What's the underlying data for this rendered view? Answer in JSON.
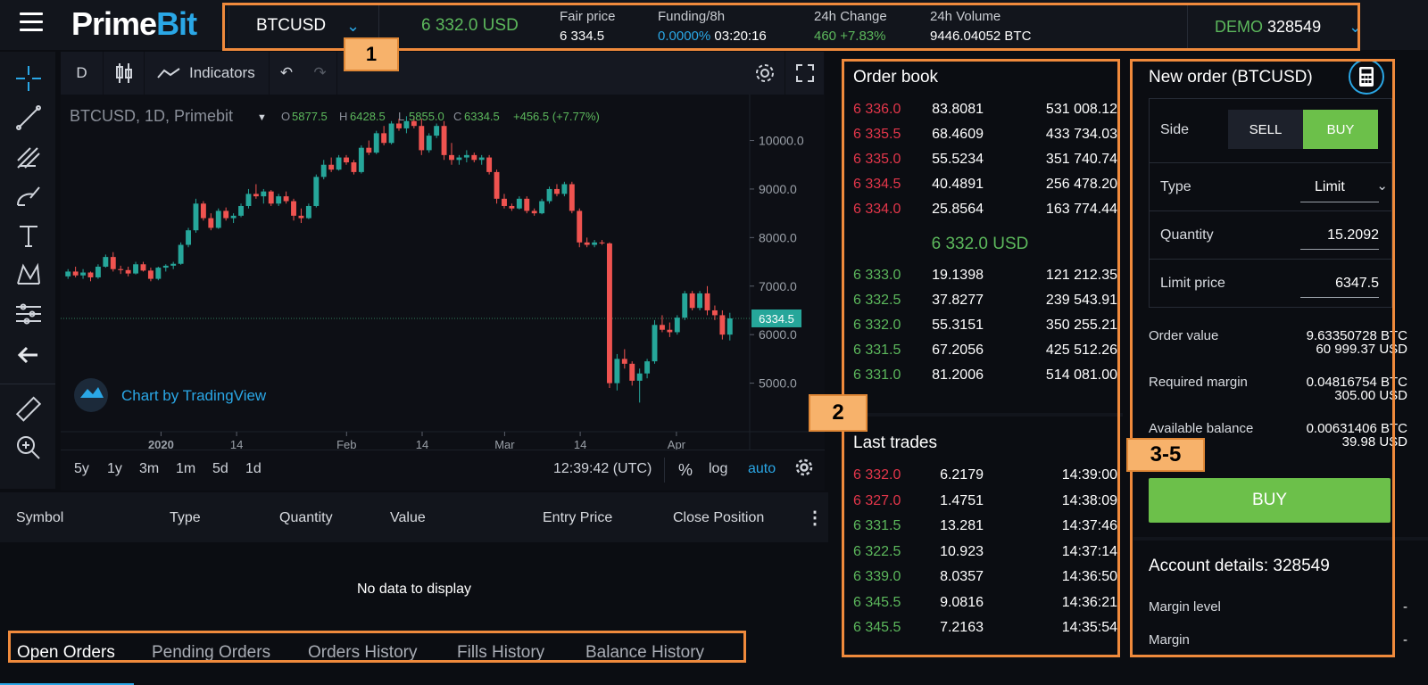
{
  "header": {
    "logo_prime": "Prime",
    "logo_bit": "Bit",
    "symbol": "BTCUSD",
    "last_price": "6 332.0 USD",
    "fair_price_label": "Fair price",
    "fair_price": "6 334.5",
    "funding_label": "Funding/8h",
    "funding_rate": "0.0000%",
    "funding_time": "03:20:16",
    "change_label": "24h Change",
    "change_value": "460 +7.83%",
    "volume_label": "24h Volume",
    "volume_value": "9446.04052 BTC",
    "account_label": "DEMO",
    "account_number": "328549"
  },
  "badges": {
    "b1": "1",
    "b2": "2",
    "b3": "3-5"
  },
  "tools": [
    "crosshair-icon",
    "trendline-icon",
    "pitchfork-icon",
    "brush-icon",
    "text-icon",
    "pattern-icon",
    "measure-lines-icon",
    "back-arrow-icon",
    "ruler-icon",
    "zoom-icon"
  ],
  "chart_toolbar": {
    "interval": "D",
    "indicators": "Indicators"
  },
  "chart": {
    "legend_symbol": "BTCUSD, 1D, Primebit",
    "o_label": "O",
    "o": "5877.5",
    "h_label": "H",
    "h": "6428.5",
    "l_label": "L",
    "l": "5855.0",
    "c_label": "C",
    "c": "6334.5",
    "change": "+456.5 (+7.77%)",
    "watermark": "Chart by TradingView",
    "last_price_tag": "6334.5",
    "y_ticks": [
      "10000.0",
      "9000.0",
      "8000.0",
      "7000.0",
      "6000.0",
      "5000.0"
    ],
    "x_ticks": [
      "2020",
      "14",
      "Feb",
      "14",
      "Mar",
      "14",
      "Apr"
    ]
  },
  "chart_data": {
    "type": "candlestick",
    "title": "BTCUSD, 1D, Primebit",
    "ylim": [
      4000,
      10800
    ],
    "up_color": "#26a69a",
    "down_color": "#ef5350",
    "candles": [
      [
        7200,
        7350,
        7150,
        7300
      ],
      [
        7300,
        7400,
        7180,
        7220
      ],
      [
        7220,
        7350,
        7150,
        7280
      ],
      [
        7280,
        7300,
        7100,
        7180
      ],
      [
        7180,
        7450,
        7150,
        7400
      ],
      [
        7400,
        7650,
        7380,
        7600
      ],
      [
        7600,
        7700,
        7300,
        7350
      ],
      [
        7350,
        7420,
        7250,
        7330
      ],
      [
        7330,
        7400,
        7200,
        7260
      ],
      [
        7260,
        7500,
        7240,
        7450
      ],
      [
        7450,
        7500,
        7300,
        7320
      ],
      [
        7320,
        7380,
        7100,
        7150
      ],
      [
        7150,
        7400,
        7120,
        7380
      ],
      [
        7380,
        7450,
        7300,
        7420
      ],
      [
        7420,
        7500,
        7350,
        7460
      ],
      [
        7460,
        7900,
        7440,
        7850
      ],
      [
        7850,
        8200,
        7800,
        8150
      ],
      [
        8150,
        8800,
        8100,
        8700
      ],
      [
        8700,
        8750,
        8350,
        8400
      ],
      [
        8400,
        8500,
        8150,
        8200
      ],
      [
        8200,
        8600,
        8180,
        8550
      ],
      [
        8550,
        8620,
        8350,
        8400
      ],
      [
        8400,
        8500,
        8300,
        8450
      ],
      [
        8450,
        8700,
        8420,
        8650
      ],
      [
        8650,
        9000,
        8600,
        8900
      ],
      [
        8900,
        9100,
        8800,
        8850
      ],
      [
        8850,
        9000,
        8700,
        8950
      ],
      [
        8950,
        8980,
        8650,
        8700
      ],
      [
        8700,
        8900,
        8650,
        8850
      ],
      [
        8850,
        8950,
        8700,
        8750
      ],
      [
        8750,
        8800,
        8350,
        8450
      ],
      [
        8450,
        8600,
        8300,
        8400
      ],
      [
        8400,
        8700,
        8380,
        8650
      ],
      [
        8650,
        9300,
        8620,
        9250
      ],
      [
        9250,
        9600,
        9200,
        9500
      ],
      [
        9500,
        9650,
        9350,
        9400
      ],
      [
        9400,
        9700,
        9380,
        9650
      ],
      [
        9650,
        9700,
        9500,
        9550
      ],
      [
        9550,
        9600,
        9300,
        9350
      ],
      [
        9350,
        9900,
        9320,
        9850
      ],
      [
        9850,
        10000,
        9700,
        9750
      ],
      [
        9750,
        10200,
        9720,
        10150
      ],
      [
        10150,
        10300,
        9900,
        9950
      ],
      [
        9950,
        10400,
        9920,
        10350
      ],
      [
        10350,
        10450,
        10200,
        10250
      ],
      [
        10250,
        10500,
        10150,
        10400
      ],
      [
        10400,
        10500,
        10250,
        10300
      ],
      [
        10300,
        10450,
        9700,
        9800
      ],
      [
        9800,
        10150,
        9750,
        10100
      ],
      [
        10100,
        10350,
        10050,
        10300
      ],
      [
        10300,
        10400,
        9600,
        9700
      ],
      [
        9700,
        9950,
        9500,
        9600
      ],
      [
        9600,
        9700,
        9500,
        9650
      ],
      [
        9650,
        9800,
        9550,
        9700
      ],
      [
        9700,
        9750,
        9550,
        9600
      ],
      [
        9600,
        9700,
        9500,
        9650
      ],
      [
        9650,
        9700,
        9300,
        9350
      ],
      [
        9350,
        9400,
        8700,
        8800
      ],
      [
        8800,
        8900,
        8600,
        8650
      ],
      [
        8650,
        8700,
        8550,
        8600
      ],
      [
        8600,
        8850,
        8580,
        8800
      ],
      [
        8800,
        8850,
        8500,
        8550
      ],
      [
        8550,
        8600,
        8450,
        8500
      ],
      [
        8500,
        8800,
        8480,
        8750
      ],
      [
        8750,
        9050,
        8700,
        9000
      ],
      [
        9000,
        9100,
        8850,
        8900
      ],
      [
        8900,
        9150,
        8850,
        9100
      ],
      [
        9100,
        9150,
        8500,
        8550
      ],
      [
        8550,
        8600,
        7800,
        7900
      ],
      [
        7900,
        8000,
        7800,
        7850
      ],
      [
        7850,
        7950,
        7800,
        7900
      ],
      [
        7900,
        7950,
        7850,
        7880
      ],
      [
        7880,
        7900,
        4900,
        5000
      ],
      [
        5000,
        5600,
        4850,
        5500
      ],
      [
        5500,
        5700,
        5300,
        5400
      ],
      [
        5400,
        5450,
        4950,
        5050
      ],
      [
        5050,
        5300,
        4600,
        5200
      ],
      [
        5200,
        5500,
        5100,
        5450
      ],
      [
        5450,
        6300,
        5400,
        6200
      ],
      [
        6200,
        6400,
        6050,
        6100
      ],
      [
        6100,
        6250,
        5950,
        6050
      ],
      [
        6050,
        6400,
        6000,
        6350
      ],
      [
        6350,
        6900,
        6300,
        6850
      ],
      [
        6850,
        6900,
        6500,
        6550
      ],
      [
        6550,
        6900,
        6500,
        6850
      ],
      [
        6850,
        7000,
        6400,
        6500
      ],
      [
        6500,
        6600,
        6300,
        6400
      ],
      [
        6400,
        6500,
        5900,
        6000
      ],
      [
        6000,
        6450,
        5880,
        6334.5
      ]
    ],
    "last_price": 6334.5
  },
  "chart_footer": {
    "ranges": [
      "5y",
      "1y",
      "3m",
      "1m",
      "5d",
      "1d"
    ],
    "time": "12:39:42 (UTC)",
    "percent": "%",
    "log": "log",
    "auto": "auto"
  },
  "positions": {
    "columns": [
      "Symbol",
      "Type",
      "Quantity",
      "Value",
      "Entry Price",
      "Close Position"
    ],
    "empty": "No data to display",
    "tabs": [
      "Open Orders",
      "Pending Orders",
      "Orders History",
      "Fills History",
      "Balance History"
    ]
  },
  "orderbook": {
    "title": "Order book",
    "asks": [
      [
        "6 336.0",
        "83.8081",
        "531 008.12"
      ],
      [
        "6 335.5",
        "68.4609",
        "433 734.03"
      ],
      [
        "6 335.0",
        "55.5234",
        "351 740.74"
      ],
      [
        "6 334.5",
        "40.4891",
        "256 478.20"
      ],
      [
        "6 334.0",
        "25.8564",
        "163 774.44"
      ]
    ],
    "mid": "6 332.0 USD",
    "bids": [
      [
        "6 333.0",
        "19.1398",
        "121 212.35"
      ],
      [
        "6 332.5",
        "37.8277",
        "239 543.91"
      ],
      [
        "6 332.0",
        "55.3151",
        "350 255.21"
      ],
      [
        "6 331.5",
        "67.2056",
        "425 512.26"
      ],
      [
        "6 331.0",
        "81.2006",
        "514 081.00"
      ]
    ],
    "trades_title": "Last trades",
    "trades": [
      [
        "6 332.0",
        "6.2179",
        "14:39:00",
        "red"
      ],
      [
        "6 327.0",
        "1.4751",
        "14:38:09",
        "red"
      ],
      [
        "6 331.5",
        "13.281",
        "14:37:46",
        "green"
      ],
      [
        "6 322.5",
        "10.923",
        "14:37:14",
        "green"
      ],
      [
        "6 339.0",
        "8.0357",
        "14:36:50",
        "green"
      ],
      [
        "6 345.5",
        "9.0816",
        "14:36:21",
        "green"
      ],
      [
        "6 345.5",
        "7.2163",
        "14:35:54",
        "green"
      ]
    ]
  },
  "neworder": {
    "title": "New order (BTCUSD)",
    "side_label": "Side",
    "sell": "SELL",
    "buy": "BUY",
    "type_label": "Type",
    "type_value": "Limit",
    "qty_label": "Quantity",
    "qty_value": "15.2092",
    "limit_label": "Limit price",
    "limit_value": "6347.5",
    "order_value_label": "Order value",
    "order_value_btc": "9.63350728 BTC",
    "order_value_usd": "60 999.37 USD",
    "req_margin_label": "Required margin",
    "req_margin_btc": "0.04816754 BTC",
    "req_margin_usd": "305.00 USD",
    "avail_label": "Available balance",
    "avail_btc": "0.00631406 BTC",
    "avail_usd": "39.98 USD",
    "buy_button": "BUY",
    "account_title": "Account details: 328549",
    "margin_level_label": "Margin level",
    "margin_level_value": "-",
    "margin_label": "Margin",
    "margin_value": "-"
  }
}
